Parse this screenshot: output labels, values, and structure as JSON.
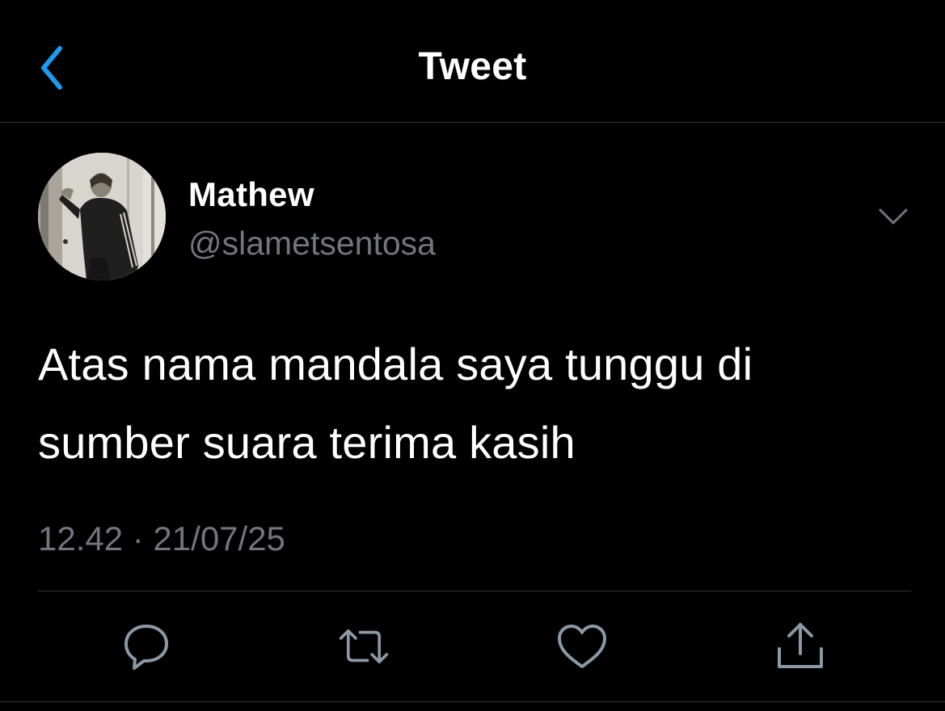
{
  "header": {
    "title": "Tweet",
    "back_icon": "chevron-left-icon",
    "accent_color": "#1d9bf0"
  },
  "tweet": {
    "author": {
      "name": "Mathew",
      "handle": "@slametsentosa"
    },
    "text": "Atas nama mandala saya tunggu di\nsumber suara terima kasih",
    "timestamp": "12.42 · 21/07/25",
    "menu_icon": "chevron-down-icon"
  },
  "actions": [
    {
      "icon": "reply-icon"
    },
    {
      "icon": "retweet-icon"
    },
    {
      "icon": "like-icon"
    },
    {
      "icon": "share-icon"
    }
  ],
  "colors": {
    "background": "#000000",
    "primary_text": "#ffffff",
    "secondary_text": "#71767b",
    "divider": "#2f3336",
    "icon": "#8b98a5"
  }
}
